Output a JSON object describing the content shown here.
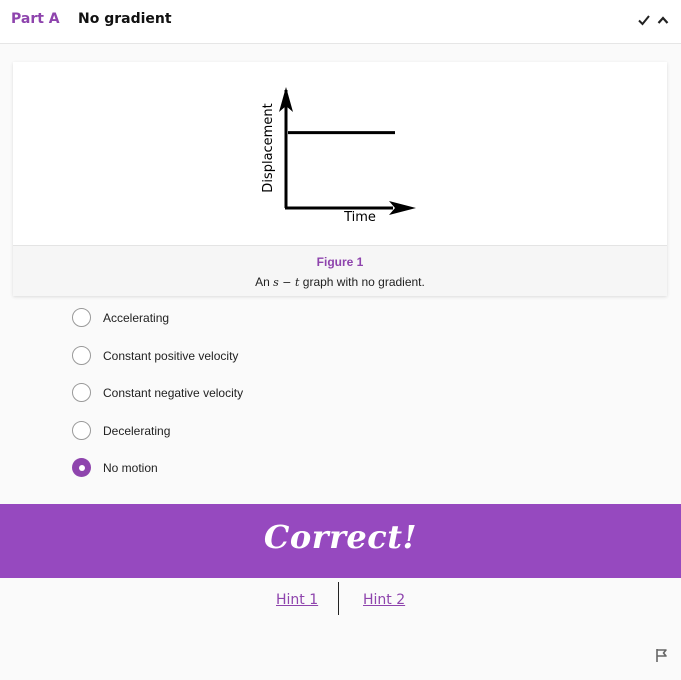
{
  "header": {
    "part_label": "Part A",
    "title": "No gradient",
    "icons": [
      "check-icon",
      "chevron-up-icon"
    ]
  },
  "figure": {
    "chart_data": {
      "type": "line",
      "x": [
        0,
        1
      ],
      "y": [
        0.65,
        0.65
      ],
      "xlabel": "Time",
      "ylabel": "Displacement",
      "title": ""
    },
    "label": "Figure 1",
    "caption_prefix": "An ",
    "caption_math": "s − t",
    "caption_suffix": " graph with no gradient."
  },
  "options": {
    "items": [
      {
        "label": "Accelerating",
        "selected": false
      },
      {
        "label": "Constant positive velocity",
        "selected": false
      },
      {
        "label": "Constant negative velocity",
        "selected": false
      },
      {
        "label": "Decelerating",
        "selected": false
      },
      {
        "label": "No motion",
        "selected": true
      }
    ]
  },
  "banner": {
    "text": "Correct!",
    "color": "#9649bf"
  },
  "hints": {
    "hint1": "Hint 1",
    "hint2": "Hint 2"
  },
  "footer": {
    "icon": "flag-icon"
  },
  "colors": {
    "accent": "#8e44ad"
  }
}
